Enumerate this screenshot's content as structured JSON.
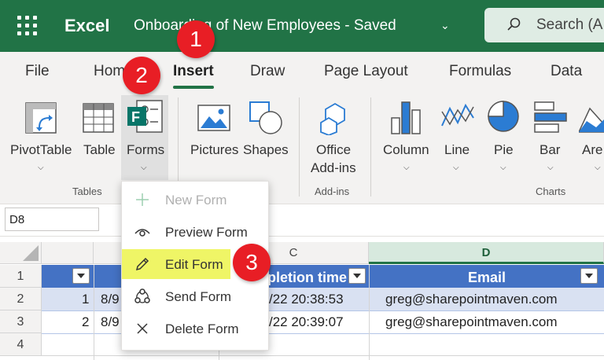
{
  "titlebar": {
    "app_name": "Excel",
    "document_title": "Onboarding of New Employees  -  Saved",
    "search_placeholder": "Search (A",
    "color": "#217346"
  },
  "tabs": [
    {
      "label": "File"
    },
    {
      "label": "Home"
    },
    {
      "label": "Insert",
      "active": true
    },
    {
      "label": "Draw"
    },
    {
      "label": "Page Layout"
    },
    {
      "label": "Formulas"
    },
    {
      "label": "Data"
    }
  ],
  "ribbon": {
    "groups": {
      "tables": "Tables",
      "addins": "Add-ins",
      "charts": "Charts"
    },
    "buttons": {
      "pivottable": "PivotTable",
      "table": "Table",
      "forms": "Forms",
      "pictures": "Pictures",
      "shapes": "Shapes",
      "office_addins_line1": "Office",
      "office_addins_line2": "Add-ins",
      "column": "Column",
      "line": "Line",
      "pie": "Pie",
      "bar": "Bar",
      "area": "Are"
    }
  },
  "name_box": "D8",
  "grid": {
    "columns": [
      {
        "label": ""
      },
      {
        "label": ""
      },
      {
        "label": "C"
      },
      {
        "label": "D",
        "selected": true
      }
    ],
    "rows": [
      "1",
      "2",
      "3",
      "4"
    ],
    "header_row": {
      "completion_time": "pletion time",
      "email": "Email"
    },
    "data_rows": [
      {
        "id": "1",
        "date_fragment": "8/9",
        "time_fragment": "/22 20:38:53",
        "email": "greg@sharepointmaven.com"
      },
      {
        "id": "2",
        "date_fragment": "8/9",
        "time_fragment": "/22 20:39:07",
        "email": "greg@sharepointmaven.com"
      }
    ]
  },
  "forms_menu": {
    "items": [
      {
        "label": "New Form",
        "icon": "plus-icon",
        "disabled": true
      },
      {
        "label": "Preview Form",
        "icon": "eye-icon"
      },
      {
        "label": "Edit Form",
        "icon": "pencil-icon",
        "highlighted": true
      },
      {
        "label": "Send Form",
        "icon": "share-icon"
      },
      {
        "label": "Delete Form",
        "icon": "close-icon"
      }
    ],
    "highlight_color": "#eff566"
  },
  "callouts": [
    "1",
    "2",
    "3"
  ],
  "callout_color": "#e81e25"
}
